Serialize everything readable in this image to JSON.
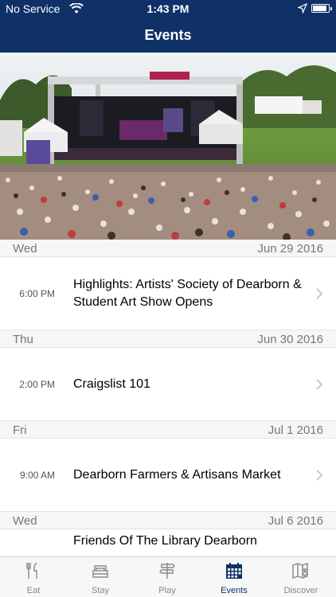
{
  "status_bar": {
    "carrier": "No Service",
    "time": "1:43 PM",
    "battery_level": 0.9
  },
  "header": {
    "title": "Events"
  },
  "hero": {
    "icon": "concert-photo"
  },
  "days": [
    {
      "weekday": "Wed",
      "date": "Jun 29 2016",
      "events": [
        {
          "time": "6:00 PM",
          "name": "Highlights: Artists' Society of Dearborn & Student Art Show Opens"
        }
      ]
    },
    {
      "weekday": "Thu",
      "date": "Jun 30 2016",
      "events": [
        {
          "time": "2:00 PM",
          "name": "Craigslist 101"
        }
      ]
    },
    {
      "weekday": "Fri",
      "date": "Jul 1 2016",
      "events": [
        {
          "time": "9:00 AM",
          "name": "Dearborn Farmers & Artisans Market"
        }
      ]
    },
    {
      "weekday": "Wed",
      "date": "Jul 6 2016",
      "events": [
        {
          "time": "",
          "name": "Friends Of The Library Dearborn"
        }
      ]
    }
  ],
  "tabbar": {
    "tabs": [
      {
        "label": "Eat",
        "icon": "fork-knife-icon"
      },
      {
        "label": "Stay",
        "icon": "bed-icon"
      },
      {
        "label": "Play",
        "icon": "signpost-icon"
      },
      {
        "label": "Events",
        "icon": "calendar-icon"
      },
      {
        "label": "Discover",
        "icon": "map-pin-icon"
      }
    ],
    "active": "Events"
  },
  "colors": {
    "header": "#0f3168",
    "active_tab": "#0f3168",
    "inactive_tab": "#888888",
    "section_bg": "#f6f6f6"
  }
}
